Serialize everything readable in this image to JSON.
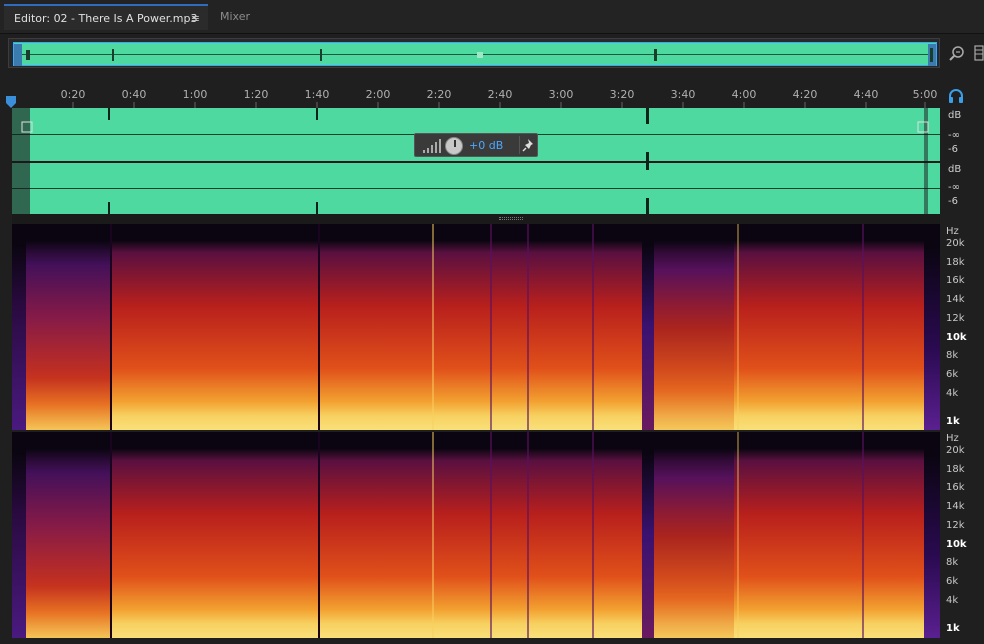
{
  "tabs": [
    {
      "label": "Editor: 02 - There Is A Power.mp3",
      "menu": "≡",
      "active": true
    },
    {
      "label": "Mixer",
      "active": false
    }
  ],
  "ruler": {
    "unit": "hms",
    "ticks": [
      "0:20",
      "0:40",
      "1:00",
      "1:20",
      "1:40",
      "2:00",
      "2:20",
      "2:40",
      "3:00",
      "3:20",
      "3:40",
      "4:00",
      "4:20",
      "4:40",
      "5:00"
    ]
  },
  "waveform": {
    "channels": [
      {
        "db_unit": "dB",
        "db_marks": [
          "-∞",
          "-6"
        ]
      },
      {
        "db_unit": "dB",
        "db_marks": [
          "-∞",
          "-6"
        ]
      }
    ],
    "color": "#4ed9a0"
  },
  "hud": {
    "value": "+0 dB"
  },
  "spectral": {
    "unit": "Hz",
    "labels": [
      "20k",
      "18k",
      "16k",
      "14k",
      "12k",
      "10k",
      "8k",
      "6k",
      "4k",
      "1k"
    ],
    "bold": [
      "10k",
      "1k"
    ]
  },
  "icons": {
    "zoom": "zoom-icon",
    "headphone": "headphone-icon",
    "pin": "pin-icon",
    "volume": "volume-icon"
  }
}
